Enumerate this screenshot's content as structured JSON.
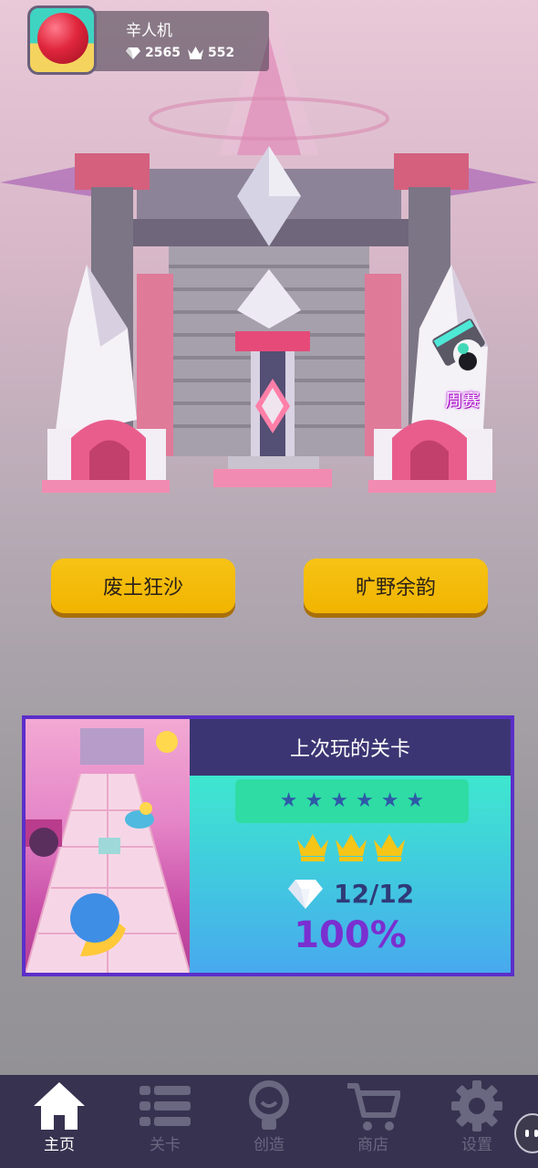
{
  "player": {
    "name": "辛人机",
    "gems": "2565",
    "crowns": "552"
  },
  "weekly": {
    "label": "周赛"
  },
  "modes": [
    {
      "label": "废土狂沙"
    },
    {
      "label": "旷野余韵"
    }
  ],
  "last_level": {
    "title": "上次玩的关卡",
    "stars": 6,
    "crowns": 3,
    "gems": "12/12",
    "percent": "100%"
  },
  "tabs": [
    {
      "label": "主页",
      "icon": "home-icon",
      "active": true
    },
    {
      "label": "关卡",
      "icon": "list-icon",
      "active": false
    },
    {
      "label": "创造",
      "icon": "lightbulb-icon",
      "active": false
    },
    {
      "label": "商店",
      "icon": "cart-icon",
      "active": false
    },
    {
      "label": "设置",
      "icon": "gear-icon",
      "active": false
    }
  ],
  "colors": {
    "button_gold": "#f3b90c",
    "card_border": "#5b2fc9",
    "tabbar": "#37324f",
    "percent": "#7a2fd0"
  }
}
